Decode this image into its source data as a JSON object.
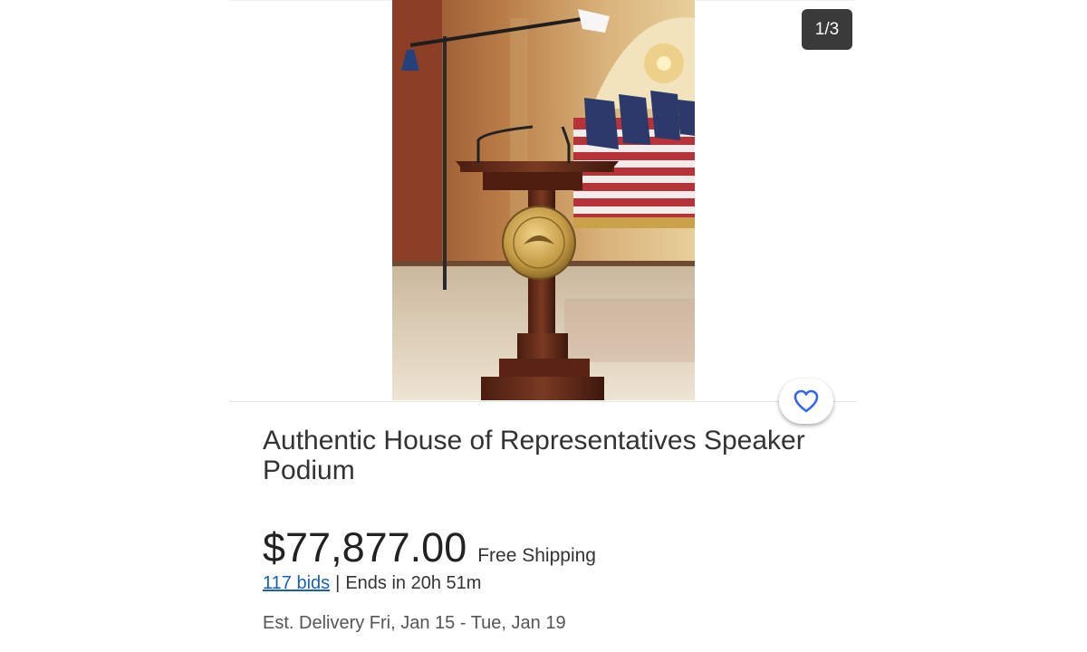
{
  "gallery": {
    "counter": "1/3",
    "image_alt": "Wooden podium with gold seal in front of American flags"
  },
  "listing": {
    "title": "Authentic House of Representatives Speaker Podium",
    "price": "$77,877.00",
    "shipping": "Free Shipping",
    "bids": "117 bids",
    "separator": "|",
    "ends": "Ends in 20h 51m",
    "delivery": "Est. Delivery Fri, Jan 15 - Tue, Jan 19"
  },
  "colors": {
    "link": "#1a5fb4",
    "heart": "#3665f3"
  },
  "icons": {
    "watch": "heart-icon"
  }
}
